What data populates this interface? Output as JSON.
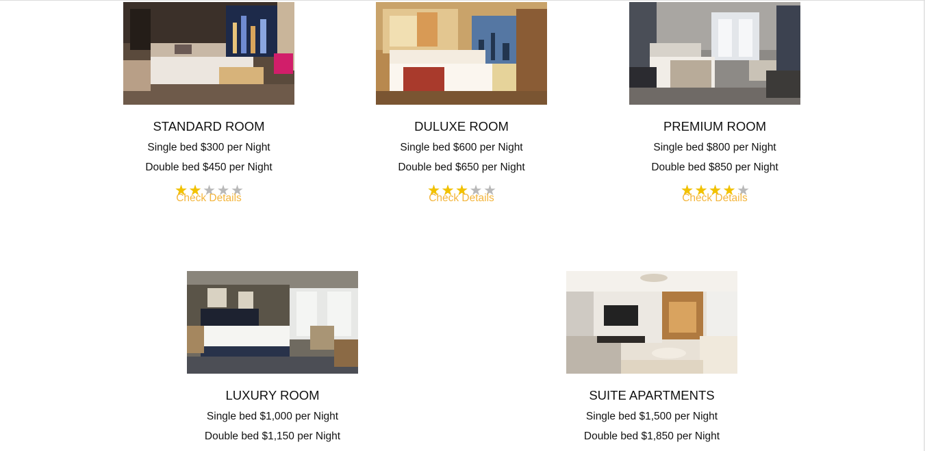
{
  "rooms": [
    {
      "name": "STANDARD ROOM",
      "single": "Single bed $300 per Night",
      "double": "Double bed $450 per Night",
      "rating": 2,
      "details_label": "Check Details"
    },
    {
      "name": "DULUXE ROOM",
      "single": "Single bed $600 per Night",
      "double": "Double bed $650 per Night",
      "rating": 3,
      "details_label": "Check Details"
    },
    {
      "name": "PREMIUM ROOM",
      "single": "Single bed $800 per Night",
      "double": "Double bed $850 per Night",
      "rating": 4,
      "details_label": "Check Details"
    },
    {
      "name": "LUXURY ROOM",
      "single": "Single bed $1,000 per Night",
      "double": "Double bed $1,150 per Night"
    },
    {
      "name": "SUITE APARTMENTS",
      "single": "Single bed $1,500 per Night",
      "double": "Double bed $1,850 per Night"
    }
  ],
  "rating_max": 5,
  "colors": {
    "star_on": "#f2c200",
    "star_off": "#b9b9b9",
    "link": "#f3b43a"
  },
  "icons": {
    "star": "star-icon"
  }
}
